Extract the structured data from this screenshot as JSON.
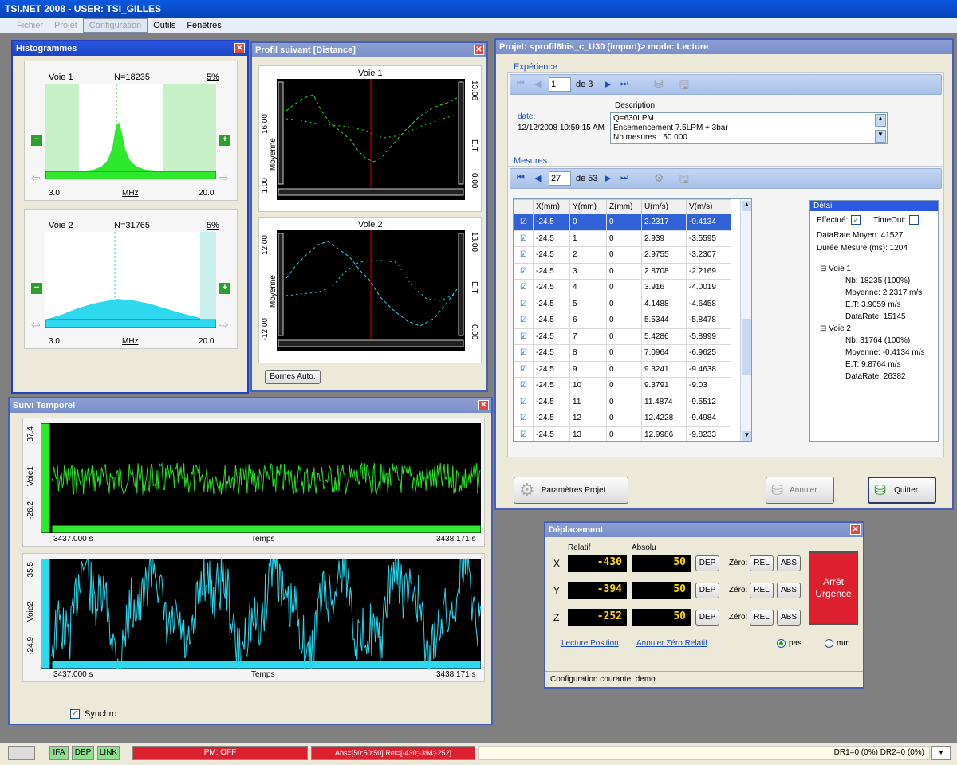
{
  "app": {
    "title": "TSI.NET 2008 - USER: TSI_GILLES"
  },
  "menu": [
    {
      "label": "Fichier",
      "state": "disabled"
    },
    {
      "label": "Projet",
      "state": "disabled"
    },
    {
      "label": "Configuration",
      "state": "boxed"
    },
    {
      "label": "Outils",
      "state": "normal"
    },
    {
      "label": "Fenêtres",
      "state": "normal"
    }
  ],
  "histogrammes": {
    "title": "Histogrammes",
    "voie1": {
      "label": "Voie 1",
      "n": "N=18235",
      "pct": "5%",
      "xmin": "3.0",
      "unit": "MHz",
      "xmax": "20.0"
    },
    "voie2": {
      "label": "Voie 2",
      "n": "N=31765",
      "pct": "5%",
      "xmin": "3.0",
      "unit": "MHz",
      "xmax": "20.0"
    }
  },
  "profil": {
    "title": "Profil suivant [Distance]",
    "voie1": {
      "label": "Voie 1",
      "y_left_top": "16.00",
      "y_left_bottom": "1.00",
      "y_left_name": "Moyenne",
      "y_right_top": "13.06",
      "y_right_bottom": "0.00",
      "y_right_name": "E.T"
    },
    "voie2": {
      "label": "Voie 2",
      "y_left_top": "12.00",
      "y_left_bottom": "-12.00",
      "y_left_name": "Moyenne",
      "y_right_top": "13.00",
      "y_right_bottom": "0.00",
      "y_right_name": "E.T"
    },
    "bornes_button": "Bornes Auto."
  },
  "suivi": {
    "title": "Suivi Temporel",
    "voie1": {
      "name": "Voie1",
      "ytop": "37.4",
      "ybottom": "-26.2",
      "xstart": "3437.000 s",
      "xlabel": "Temps",
      "xend": "3438.171 s"
    },
    "voie2": {
      "name": "Voie2",
      "ytop": "35.5",
      "ybottom": "-24.9",
      "xstart": "3437.000 s",
      "xlabel": "Temps",
      "xend": "3438.171 s"
    },
    "synchro_label": "Synchro"
  },
  "projet": {
    "title": "Projet: <profil6bis_c_U30 (import)> mode: Lecture",
    "experience": {
      "group": "Expérience",
      "current": "1",
      "of": "de 3",
      "date_label": "date:",
      "date_value": "12/12/2008 10:59:15 AM",
      "description_label": "Description",
      "description_lines": [
        "Q=630LPM",
        "Ensemencement 7.5LPM + 3bar",
        "Nb mesures : 50 000"
      ]
    },
    "mesures": {
      "group": "Mesures",
      "current": "27",
      "of": "de 53",
      "columns": [
        "X(mm)",
        "Y(mm)",
        "Z(mm)",
        "U(m/s)",
        "V(m/s)"
      ],
      "rows": [
        [
          "-24.5",
          "0",
          "0",
          "2.2317",
          "-0.4134"
        ],
        [
          "-24.5",
          "1",
          "0",
          "2.939",
          "-3.5595"
        ],
        [
          "-24.5",
          "2",
          "0",
          "2.9755",
          "-3.2307"
        ],
        [
          "-24.5",
          "3",
          "0",
          "2.8708",
          "-2.2169"
        ],
        [
          "-24.5",
          "4",
          "0",
          "3.916",
          "-4.0019"
        ],
        [
          "-24.5",
          "5",
          "0",
          "4.1488",
          "-4.6458"
        ],
        [
          "-24.5",
          "6",
          "0",
          "5.5344",
          "-5.8478"
        ],
        [
          "-24.5",
          "7",
          "0",
          "5.4286",
          "-5.8999"
        ],
        [
          "-24.5",
          "8",
          "0",
          "7.0964",
          "-6.9625"
        ],
        [
          "-24.5",
          "9",
          "0",
          "9.3241",
          "-9.4638"
        ],
        [
          "-24.5",
          "10",
          "0",
          "9.3791",
          "-9.03"
        ],
        [
          "-24.5",
          "11",
          "0",
          "11.4874",
          "-9.5512"
        ],
        [
          "-24.5",
          "12",
          "0",
          "12.4228",
          "-9.4984"
        ],
        [
          "-24.5",
          "13",
          "0",
          "12.9986",
          "-9.8233"
        ]
      ]
    },
    "detail": {
      "title": "Détail",
      "effectue": "Effectué:",
      "timeout": "TimeOut:",
      "datarate_moyen": "DataRate Moyen: 41527",
      "duree": "Durée Mesure (ms): 1204",
      "voie1": {
        "label": "Voie 1",
        "items": [
          "Nb: 18235 (100%)",
          "Moyenne: 2.2317 m/s",
          "E.T: 3.9059 m/s",
          "DataRate: 15145"
        ]
      },
      "voie2": {
        "label": "Voie 2",
        "items": [
          "Nb: 31764 (100%)",
          "Moyenne: -0.4134 m/s",
          "E.T: 9.8764 m/s",
          "DataRate: 26382"
        ]
      }
    },
    "buttons": {
      "params": "Paramètres Projet",
      "annuler": "Annuler",
      "quitter": "Quitter"
    }
  },
  "deplacement": {
    "title": "Déplacement",
    "relatif_label": "Relatif",
    "absolu_label": "Absolu",
    "axes": [
      {
        "axis": "X",
        "rel": "-430",
        "abs": "50"
      },
      {
        "axis": "Y",
        "rel": "-394",
        "abs": "50"
      },
      {
        "axis": "Z",
        "rel": "-252",
        "abs": "50"
      }
    ],
    "dep_label": "DEP",
    "zero_label": "Zéro:",
    "rel_btn": "REL",
    "abs_btn": "ABS",
    "arret": "Arrêt Urgence",
    "lecture_link": "Lecture Position",
    "annuler_link": "Annuler Zéro Relatif",
    "radio_pas": "pas",
    "radio_mm": "mm",
    "config": "Configuration courante: demo"
  },
  "statusbar": {
    "ifa": "IFA",
    "dep": "DEP",
    "link": "LINK",
    "pm": "PM: OFF",
    "absrel": "Abs=[50;50;50]   Rel=[-430;-394;-252]",
    "dr": "DR1=0 (0%)  DR2=0 (0%)"
  }
}
